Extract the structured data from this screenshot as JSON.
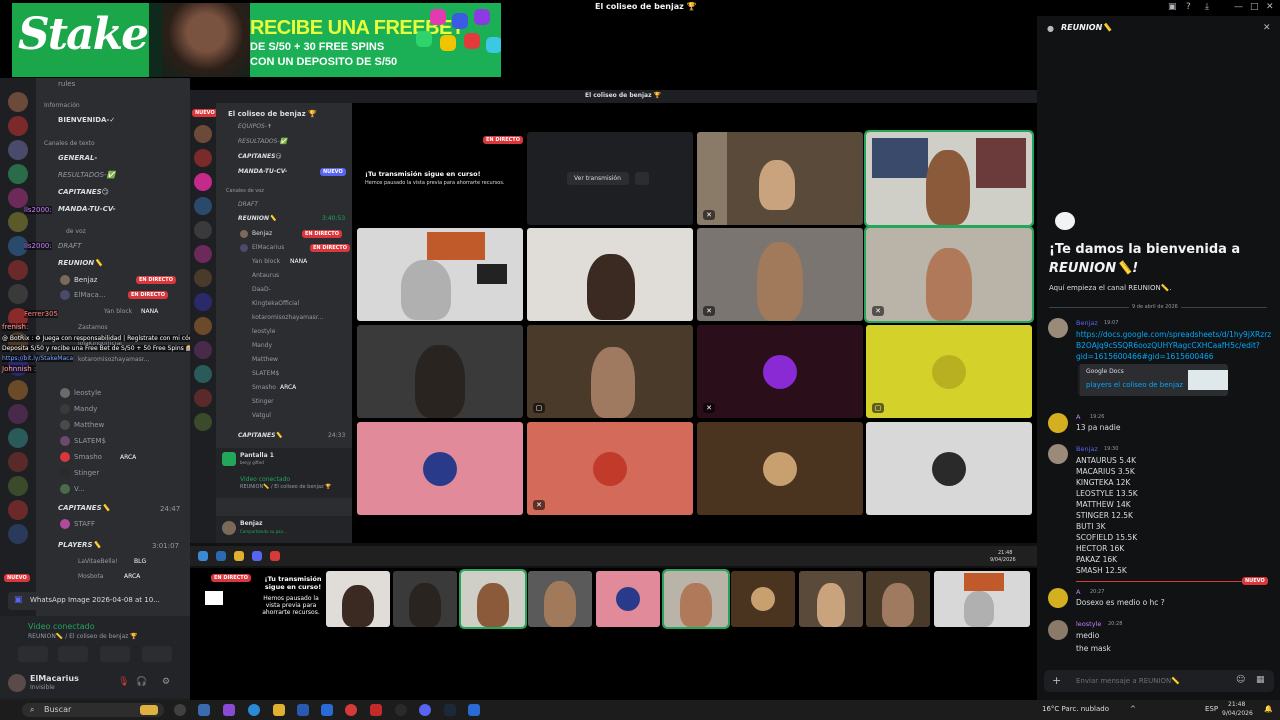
{
  "window": {
    "title": "El coliseo de benjaz 🏆"
  },
  "banner": {
    "logo": "Stake",
    "headline": "RECIBE UNA FREEBET",
    "line2": "DE S/50 + 30 FREE SPINS",
    "line3": "CON UN DEPOSITO DE S/50"
  },
  "left": {
    "rules": "rules",
    "section_info": "Información",
    "bienvenida": "BIENVENIDA-✓",
    "section_text": "Canales de texto",
    "general": "GENERAL-",
    "resultados": "RESULTADOS-✅",
    "capitanes": "CAPITANES😏",
    "manda": "MANDA-TU-CV-",
    "voice": "de voz",
    "draft": "DRAFT",
    "reunion": "REUNION📏",
    "live_label": "EN DIRECTO",
    "members": [
      "Benjaz",
      "ElMaca...",
      "Yan block",
      "Zastamos",
      "lolaKing0fficial",
      "kotaromisozhayamasr...",
      "leostyle",
      "Mandy",
      "Matthew",
      "SLATEM$",
      "Smasho",
      "Stinger",
      "V..."
    ],
    "nana": "NANA",
    "arca": "ARCA",
    "capitanes_vc": "CAPITANES📏",
    "capitanes_time": "24:47",
    "staff": "STAFF",
    "players": "PLAYERS📏",
    "players_time": "3:01:07",
    "players_members": [
      "LaVitaeBella!",
      "Mosbota"
    ],
    "blg": "BLG",
    "chat_overlay": [
      "lls2000:",
      "lls2000:",
      "Ferrer305",
      "@ BotRix : ♻ Juega con responsabilidad | Regístrate con mi código MACA y",
      "Deposita S/50 y recibe una Free Bet de S/50 + 50 Free Spins 🎰",
      "https://bit.ly/StakeMaca",
      "frenish:",
      "Johnnish :"
    ],
    "nuevo": "NUEVO",
    "whatsapp": "WhatsApp Image 2026-04-08 at 10...",
    "video": "Video conectado",
    "video_sub": "REUNION📏 / El coliseo de benjaz 🏆",
    "user": "ElMacarius",
    "user_status": "Invisible"
  },
  "inner": {
    "title": "El coliseo de benjaz 🏆",
    "server": "El coliseo de benjaz 🏆",
    "channels": [
      "EQUIPOS-✝",
      "RESULTADOS-✅",
      "CAPITANES😏",
      "MANDA-TU-CV-"
    ],
    "nuevo": "NUEVO",
    "voice_section": "Canales de voz",
    "draft": "DRAFT",
    "reunion": "REUNION📏",
    "reunion_time": "3:40:53",
    "members": [
      "Benjaz",
      "ElMacarius",
      "Yan block",
      "Antaurus",
      "DaaD-",
      "KingtekaOfficial",
      "kotaromisozhayamasr...",
      "leostyle",
      "Mandy",
      "Matthew",
      "SLATEM$",
      "Smasho",
      "Stinger",
      "Vatgul"
    ],
    "nana": "NANA",
    "arca": "ARCA",
    "capitanes_vc": "CAPITANES📏",
    "capitanes_time": "24:33",
    "screen": "Pantalla 1",
    "screen_sub": "benjy gifted",
    "video": "Video conectado",
    "video_sub": "REUNION📏 / El coliseo de benjaz 🏆",
    "user": "Benjaz",
    "user_sub": "Compartiendo su pan...",
    "live": "EN DIRECTO",
    "stream_msg1": "¡Tu transmisión sigue en curso!",
    "stream_msg2": "Hemos pausado la vista previa para ahorrarte recursos.",
    "ver": "Ver transmisión",
    "tb_time": "21:48",
    "tb_date": "9/04/2026",
    "strip_live": "EN DIRECTO",
    "strip_msg": "¡Tu transmisión sigue en curso!",
    "strip_sub": "Hemos pausado la vista previa para ahorrarte recursos."
  },
  "chat": {
    "header": "REUNION📏",
    "welcome1": "¡Te damos la bienvenida a",
    "welcome2": "REUNION📏!",
    "sub": "Aquí empieza el canal REUNION📏.",
    "date": "9 de abril de 2026",
    "messages": [
      {
        "name": "Benjaz",
        "time": "19:07",
        "lines": [
          "https://docs.google.com/spreadsheets/d/1hy9jXRzrz",
          "B2OAJq9cSSQR6oozQUHYRagcCXHCaafH5c/edit?",
          "gid=1615600466#gid=1615600466"
        ]
      },
      {
        "name": "A",
        "time": "19:26",
        "lines": [
          "13 pa nadie"
        ]
      },
      {
        "name": "Benjaz",
        "time": "19:30",
        "lines": [
          "ANTAURUS 5.4K",
          "MACARIUS 3.5K",
          "KINGTEKA 12K",
          "LEOSTYLE 13.5K",
          "MATTHEW 14K",
          "STINGER 12.5K",
          "BUTI 3K",
          "SCOFIELD 15.5K",
          "HECTOR 16K",
          "PAKAZ 16K",
          "SMASH 12.5K"
        ]
      },
      {
        "name": "A",
        "time": "20:27",
        "lines": [
          "Dosexo es medio o hc ?"
        ]
      },
      {
        "name": "leostyle",
        "time": "20:28",
        "lines": [
          "medio",
          "the mask"
        ]
      }
    ],
    "embed_source": "Google Docs",
    "embed_title": "players el coliseo de benjaz",
    "nuevo": "NUEVO",
    "input_placeholder": "Enviar mensaje a REUNION📏"
  },
  "taskbar": {
    "search": "Buscar",
    "weather": "16°C Parc. nublado",
    "lang": "ESP",
    "time": "21:48",
    "date": "9/04/2026"
  },
  "colors": {
    "accent": "#5865f2",
    "live": "#da373c",
    "link": "#00a8fc",
    "stake_green": "#1ba64a"
  }
}
